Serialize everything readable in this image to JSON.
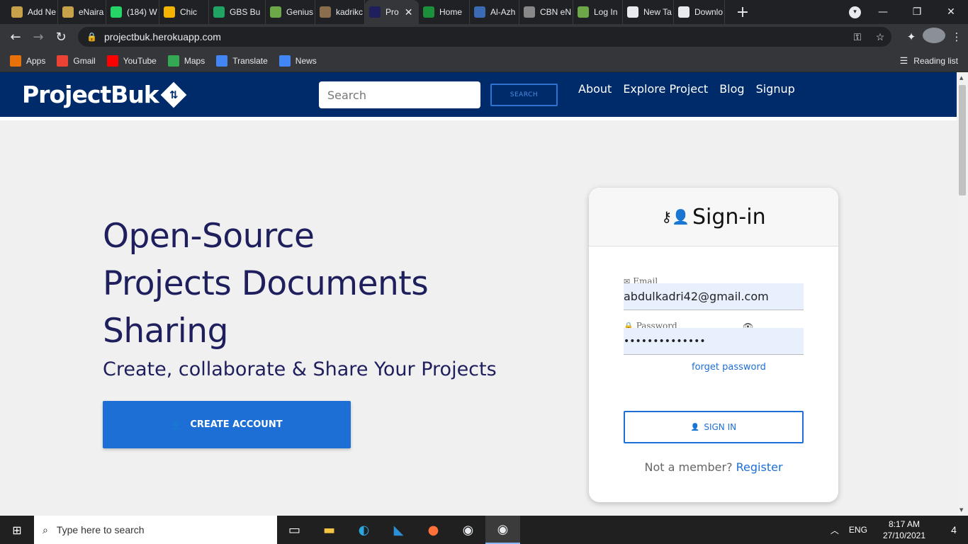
{
  "browser": {
    "tabs": [
      {
        "title": "Add Ne",
        "icon": "user-icon",
        "color": "#c8a24a"
      },
      {
        "title": "eNaira",
        "icon": "user-icon",
        "color": "#c8a24a"
      },
      {
        "title": "(184) W",
        "icon": "whatsapp-icon",
        "color": "#25d366"
      },
      {
        "title": "Chic",
        "icon": "page-icon",
        "color": "#f4b400"
      },
      {
        "title": "GBS Bu",
        "icon": "drive-icon",
        "color": "#1fa463"
      },
      {
        "title": "Genius",
        "icon": "page-icon",
        "color": "#6ca748"
      },
      {
        "title": "kadrikc",
        "icon": "user-icon",
        "color": "#8a6e4b"
      },
      {
        "title": "Pro",
        "icon": "page-icon",
        "color": "#1e1f5c",
        "active": true
      },
      {
        "title": "Home",
        "icon": "page-icon",
        "color": "#1b8f3a"
      },
      {
        "title": "Al-Azh",
        "icon": "page-icon",
        "color": "#3b6bb5"
      },
      {
        "title": "CBN eN",
        "icon": "page-icon",
        "color": "#888888"
      },
      {
        "title": "Log In",
        "icon": "page-icon",
        "color": "#6ca748"
      },
      {
        "title": "New Ta",
        "icon": "chrome-icon",
        "color": "#e8eaed"
      },
      {
        "title": "Downlo",
        "icon": "download-icon",
        "color": "#e8eaed"
      }
    ],
    "url": "projectbuk.herokuapp.com",
    "bookmarks": [
      {
        "label": "Apps",
        "icon": "apps-grid-icon",
        "color": "#e8710a"
      },
      {
        "label": "Gmail",
        "icon": "gmail-icon",
        "color": "#ea4335"
      },
      {
        "label": "YouTube",
        "icon": "youtube-icon",
        "color": "#ff0000"
      },
      {
        "label": "Maps",
        "icon": "maps-icon",
        "color": "#34a853"
      },
      {
        "label": "Translate",
        "icon": "translate-icon",
        "color": "#4285f4"
      },
      {
        "label": "News",
        "icon": "news-icon",
        "color": "#4285f4"
      }
    ],
    "reading_list": "Reading list"
  },
  "site": {
    "logo": "ProjectBuk",
    "search_placeholder": "Search",
    "search_button": "SEARCH",
    "nav_links": [
      "About",
      "Explore Project",
      "Blog",
      "Signup"
    ],
    "hero": {
      "title_lines": [
        "Open-Source",
        "Projects Documents",
        "Sharing"
      ],
      "subtitle": "Create, collaborate & Share Your Projects",
      "cta": "CREATE ACCOUNT"
    },
    "signin": {
      "heading": "Sign-in",
      "email_label": "Email",
      "email_value": "abdulkadri42@gmail.com",
      "password_label": "Password",
      "password_value": "••••••••••••••",
      "forgot": "forget password",
      "button": "SIGN IN",
      "not_member": "Not a member?",
      "register": "Register"
    }
  },
  "taskbar": {
    "search_placeholder": "Type here to search",
    "lang": "ENG",
    "time": "8:17 AM",
    "date": "27/10/2021",
    "notifications": "4"
  },
  "colors": {
    "nav_bg": "#002b6b",
    "accent": "#1d6fd6",
    "hero_text": "#1e1f5c"
  }
}
